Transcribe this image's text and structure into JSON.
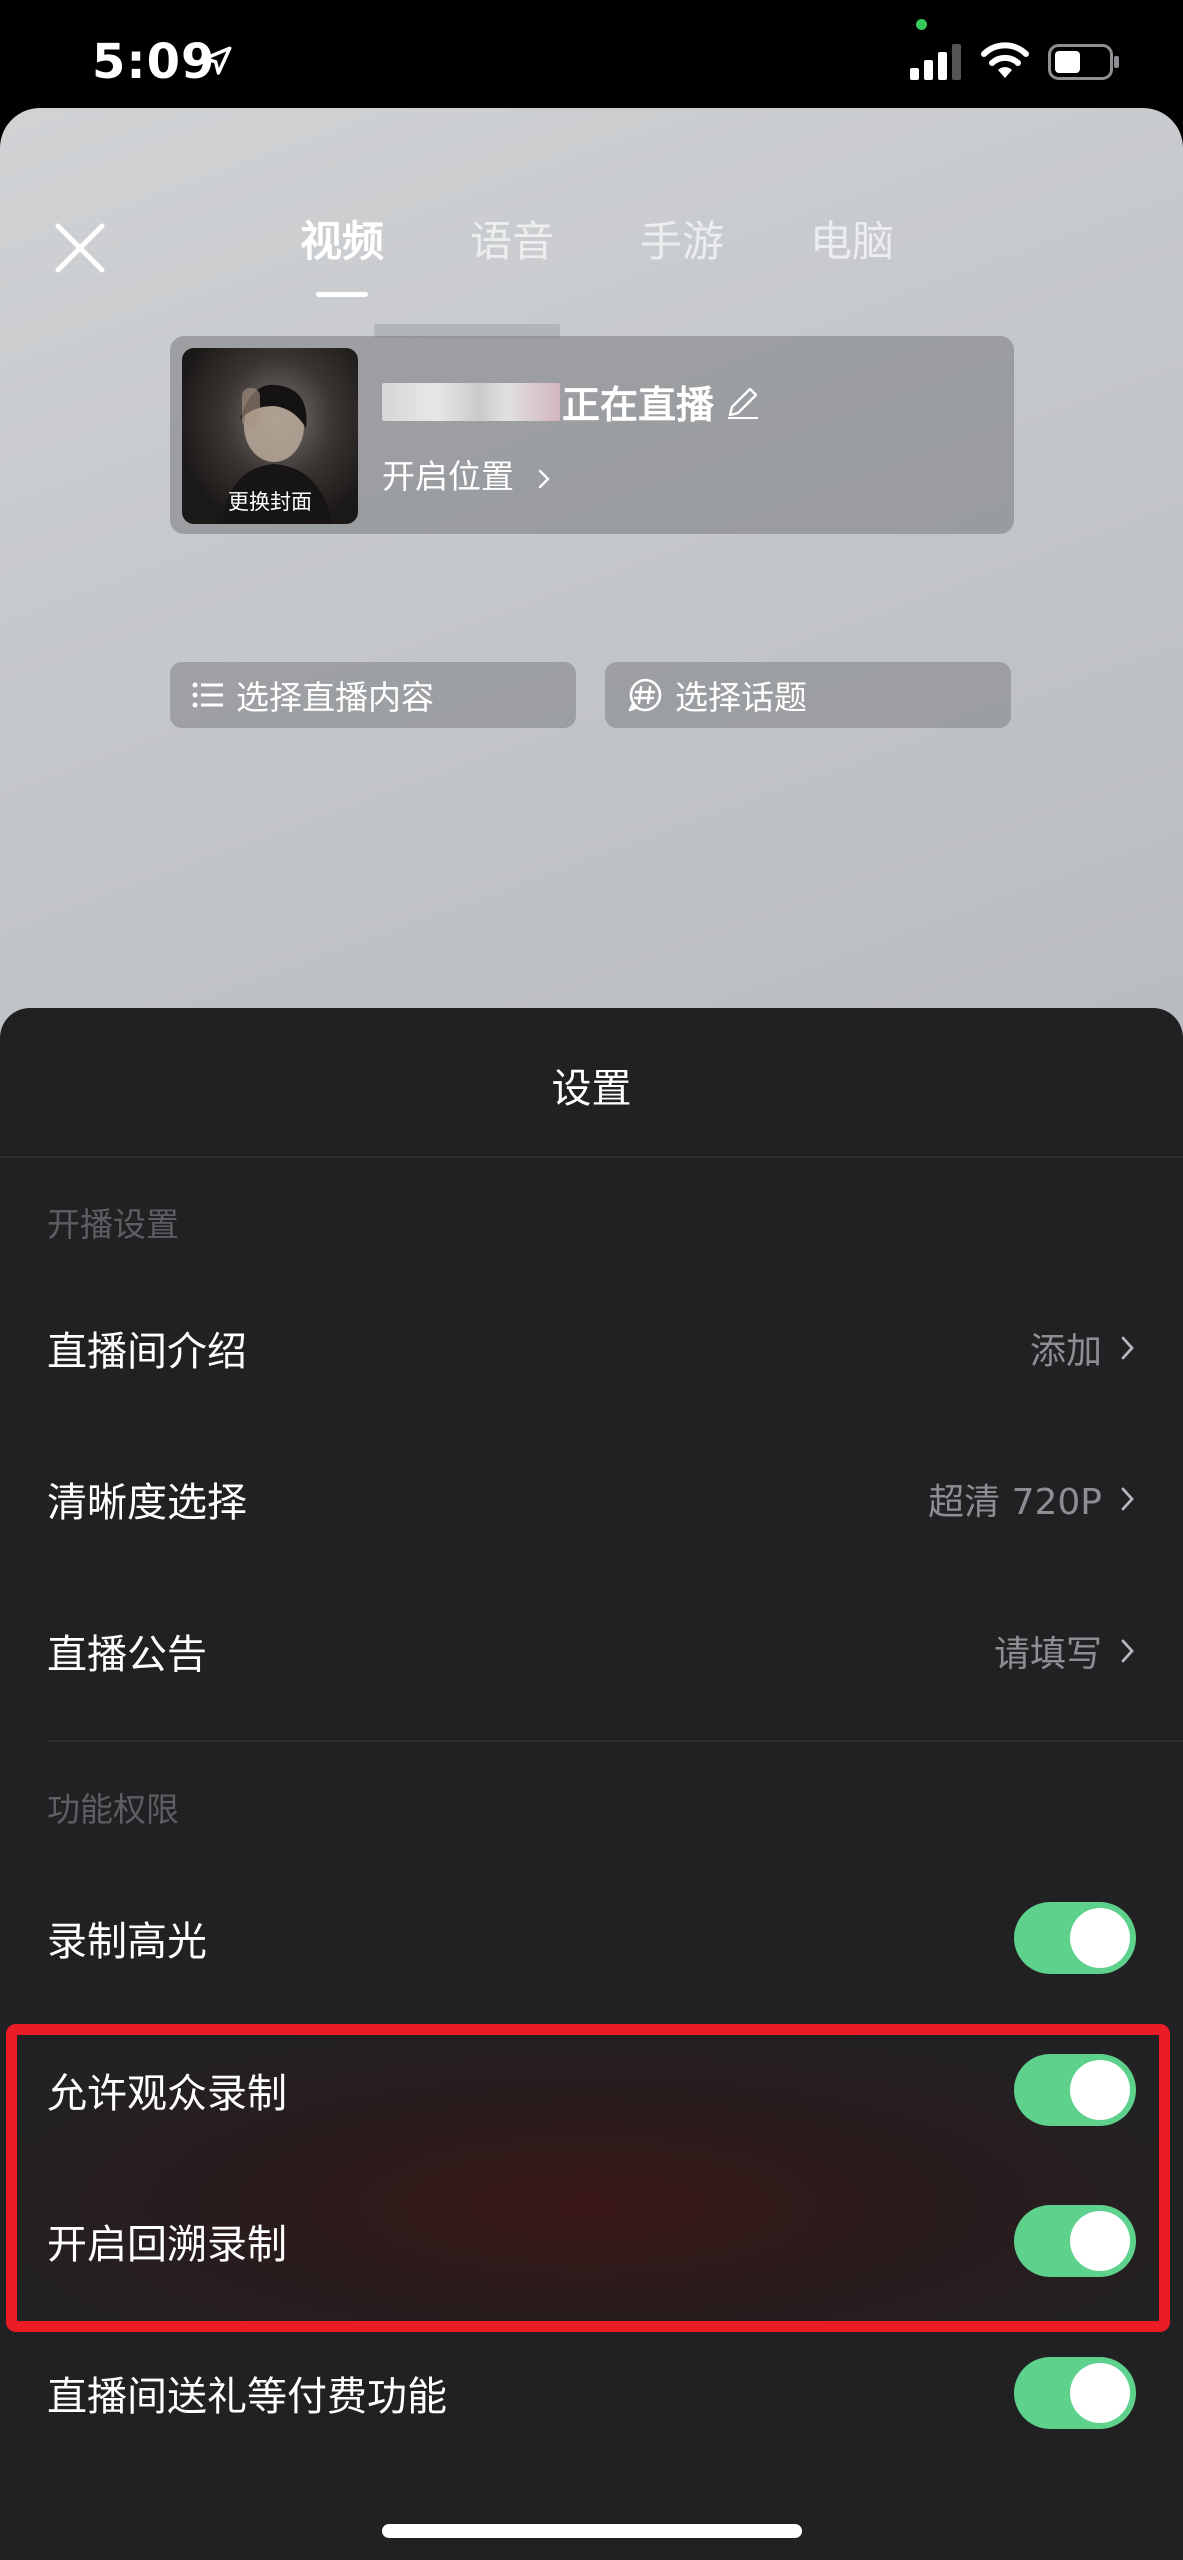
{
  "status_bar": {
    "time": "5:09"
  },
  "tabs": [
    {
      "label": "视频",
      "active": true
    },
    {
      "label": "语音",
      "active": false
    },
    {
      "label": "手游",
      "active": false
    },
    {
      "label": "电脑",
      "active": false
    }
  ],
  "info_card": {
    "cover_label": "更换封面",
    "title_suffix": "正在直播",
    "location": "开启位置"
  },
  "chips": {
    "content": "选择直播内容",
    "topic": "选择话题"
  },
  "settings": {
    "title": "设置",
    "section_broadcast": "开播设置",
    "intro_label": "直播间介绍",
    "intro_value": "添加",
    "quality_label": "清晰度选择",
    "quality_value": "超清 720P",
    "notice_label": "直播公告",
    "notice_value": "请填写",
    "section_permissions": "功能权限",
    "highlight_label": "录制高光",
    "highlight_on": true,
    "audience_record_label": "允许观众录制",
    "audience_record_on": true,
    "rewind_label": "开启回溯录制",
    "rewind_on": true,
    "gift_label": "直播间送礼等付费功能",
    "gift_on": true
  },
  "colors": {
    "toggle_on": "#5ed18c",
    "highlight_border": "#ec1c24",
    "sheet_bg": "#212123"
  }
}
